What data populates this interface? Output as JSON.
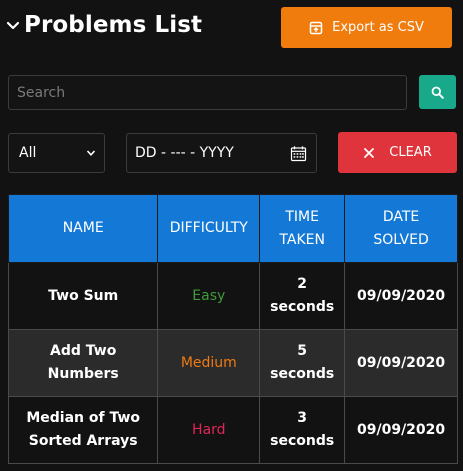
{
  "header": {
    "title": "Problems List",
    "export_label": "Export as CSV"
  },
  "search": {
    "placeholder": "Search",
    "value": ""
  },
  "filters": {
    "difficulty_selected": "All",
    "date_placeholder": "DD - --- - YYYY",
    "clear_label": "CLEAR"
  },
  "table": {
    "headers": {
      "name": "NAME",
      "difficulty": "DIFFICULTY",
      "time_line1": "TIME",
      "time_line2": "TAKEN",
      "date_line1": "DATE",
      "date_line2": "SOLVED"
    },
    "rows": [
      {
        "name_line1": "Two Sum",
        "name_line2": "",
        "difficulty": "Easy",
        "difficulty_color": "#3e9a3c",
        "time_line1": "2",
        "time_line2": "seconds",
        "date": "09/09/2020"
      },
      {
        "name_line1": "Add Two",
        "name_line2": "Numbers",
        "difficulty": "Medium",
        "difficulty_color": "#ef7a12",
        "time_line1": "5",
        "time_line2": "seconds",
        "date": "09/09/2020"
      },
      {
        "name_line1": "Median of Two",
        "name_line2": "Sorted Arrays",
        "difficulty": "Hard",
        "difficulty_color": "#e0255a",
        "time_line1": "3",
        "time_line2": "seconds",
        "date": "09/09/2020"
      }
    ]
  },
  "colors": {
    "export_button": "#f07c0e",
    "search_button": "#17a98a",
    "clear_button": "#e0343d",
    "table_header": "#1479d6"
  },
  "icons": {
    "collapse": "chevron-down-icon",
    "export": "export-icon",
    "search": "search-icon",
    "select": "dropdown-chevron-icon",
    "calendar": "calendar-icon",
    "clear": "close-icon"
  }
}
